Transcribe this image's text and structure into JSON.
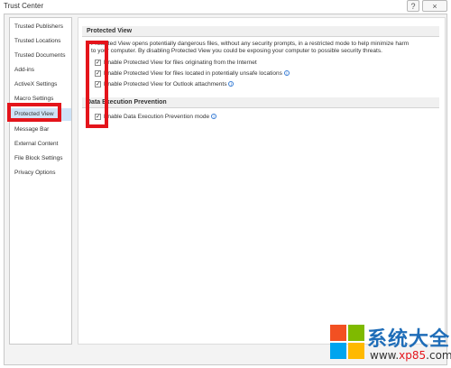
{
  "window": {
    "title": "Trust Center",
    "help_label": "?",
    "close_label": "×"
  },
  "sidebar": {
    "items": [
      {
        "label": "Trusted Publishers"
      },
      {
        "label": "Trusted Locations"
      },
      {
        "label": "Trusted Documents"
      },
      {
        "label": "Add-ins"
      },
      {
        "label": "ActiveX Settings"
      },
      {
        "label": "Macro Settings"
      },
      {
        "label": "Protected View"
      },
      {
        "label": "Message Bar"
      },
      {
        "label": "External Content"
      },
      {
        "label": "File Block Settings"
      },
      {
        "label": "Privacy Options"
      }
    ],
    "active_item": "Protected View"
  },
  "protected_view": {
    "header": "Protected View",
    "description_1": "Protected View opens potentially dangerous files, without any security prompts, in a restricted mode to help minimize harm",
    "description_2": "to your computer. By disabling Protected View you could be exposing your computer to possible security threats.",
    "options": [
      {
        "label": "Enable Protected View for files originating from the Internet",
        "checked": true,
        "info": false
      },
      {
        "label": "Enable Protected View for files located in potentially unsafe locations",
        "checked": true,
        "info": true
      },
      {
        "label": "Enable Protected View for Outlook attachments",
        "checked": true,
        "info": true
      }
    ]
  },
  "dep": {
    "header": "Data Execution Prevention",
    "options": [
      {
        "label": "Enable Data Execution Prevention mode",
        "checked": true,
        "info": true
      }
    ]
  },
  "watermark": {
    "title": "系统大全",
    "url_prefix": "www.",
    "url_hi": "xp85",
    "url_suffix": ".com"
  },
  "colors": {
    "highlight_box": "#e4141b",
    "active_nav": "#cfe3f7"
  },
  "icons": {
    "check": "✓",
    "info": "i"
  }
}
